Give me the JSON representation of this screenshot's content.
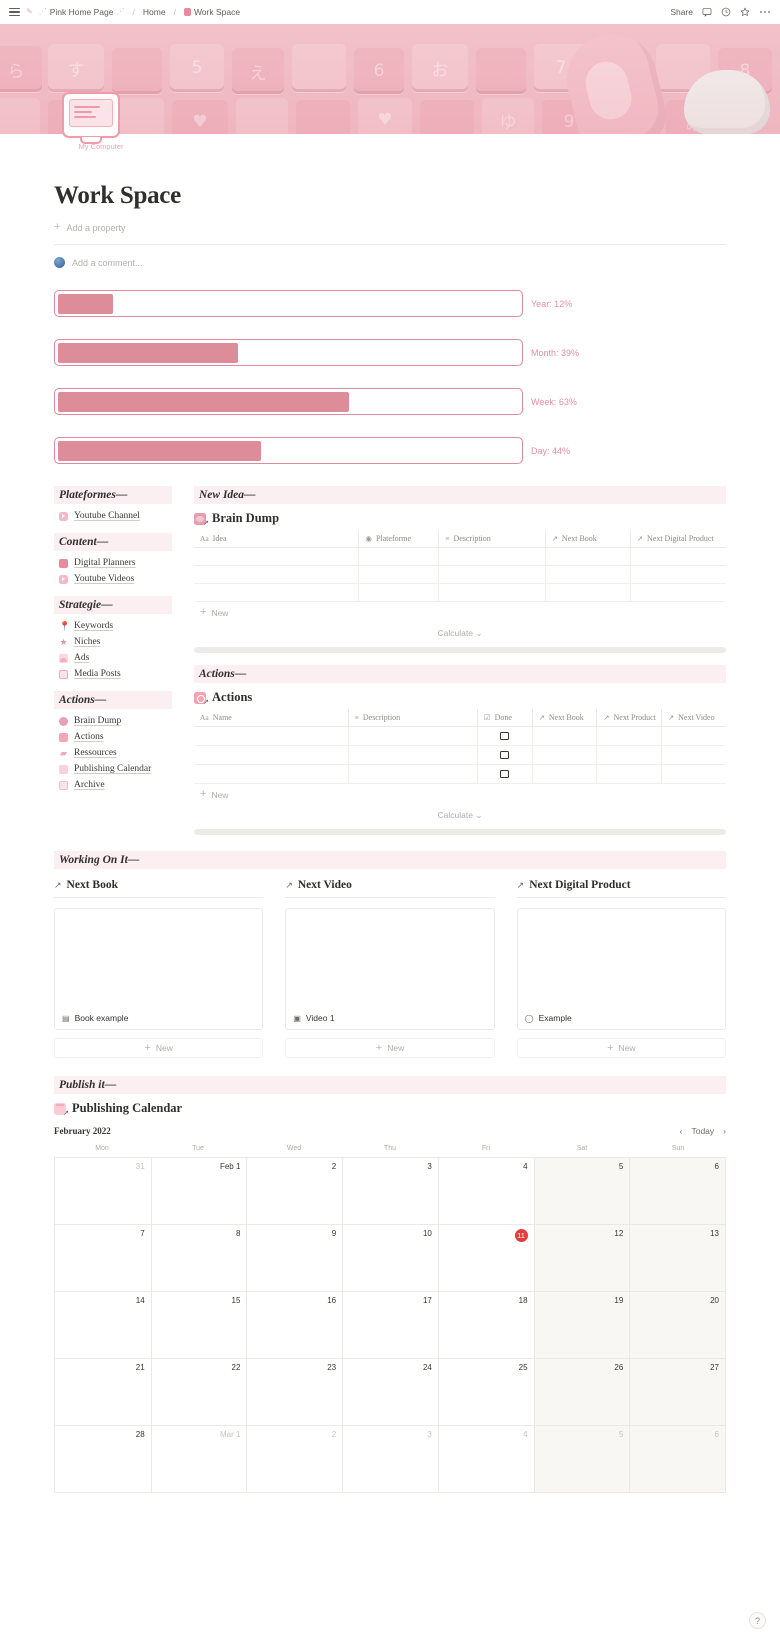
{
  "topbar": {
    "breadcrumbs": [
      {
        "icon": "pink-pen-icon",
        "label": "Pink Home Page"
      },
      {
        "icon": "",
        "label": "Home"
      },
      {
        "icon": "book-icon",
        "label": "Work Space"
      }
    ],
    "share_label": "Share",
    "icons": [
      "comment-icon",
      "clock-icon",
      "star-icon",
      "more-icon"
    ]
  },
  "page_icon": {
    "label": "My Computer"
  },
  "header": {
    "title": "Work Space",
    "add_property": "Add a property",
    "add_comment": "Add a comment..."
  },
  "progress": [
    {
      "label": "Year: 12%",
      "percent": 12
    },
    {
      "label": "Month: 39%",
      "percent": 39
    },
    {
      "label": "Week: 63%",
      "percent": 63
    },
    {
      "label": "Day: 44%",
      "percent": 44
    }
  ],
  "sidebar": {
    "groups": [
      {
        "heading": "Plateformes—",
        "items": [
          {
            "label": "Youtube Channel",
            "icon": "youtube-icon"
          }
        ]
      },
      {
        "heading": "Content—",
        "items": [
          {
            "label": "Digital Planners",
            "icon": "book-icon"
          },
          {
            "label": "Youtube Videos",
            "icon": "youtube-icon"
          }
        ]
      },
      {
        "heading": "Strategie—",
        "items": [
          {
            "label": "Keywords",
            "icon": "pin-icon"
          },
          {
            "label": "Niches",
            "icon": "star-icon"
          },
          {
            "label": "Ads",
            "icon": "image-icon"
          },
          {
            "label": "Media Posts",
            "icon": "media-icon"
          }
        ]
      },
      {
        "heading": "Actions—",
        "items": [
          {
            "label": "Brain Dump",
            "icon": "brain-icon"
          },
          {
            "label": "Actions",
            "icon": "actions-icon"
          },
          {
            "label": "Ressources",
            "icon": "ressources-icon"
          },
          {
            "label": "Publishing Calendar",
            "icon": "calendar-icon"
          },
          {
            "label": "Archive",
            "icon": "archive-icon"
          }
        ]
      }
    ]
  },
  "new_idea": {
    "heading": "New Idea—",
    "db_title": "Brain Dump",
    "db_icon": "brain-dump-icon",
    "columns": [
      {
        "label": "Idea",
        "type_glyph": "Aa"
      },
      {
        "label": "Plateforme",
        "type_glyph": "◉"
      },
      {
        "label": "Description",
        "type_glyph": "≡"
      },
      {
        "label": "Next Book",
        "type_glyph": "↗"
      },
      {
        "label": "Next Digital Product",
        "type_glyph": "↗"
      }
    ],
    "row_count": 3,
    "new_label": "New",
    "calculate_label": "Calculate"
  },
  "actions": {
    "heading": "Actions—",
    "db_title": "Actions",
    "db_icon": "actions-db-icon",
    "columns": [
      {
        "label": "Name",
        "type_glyph": "Aa"
      },
      {
        "label": "Description",
        "type_glyph": "≡"
      },
      {
        "label": "Done",
        "type_glyph": "☑"
      },
      {
        "label": "Next Book",
        "type_glyph": "↗"
      },
      {
        "label": "Next Product",
        "type_glyph": "↗"
      },
      {
        "label": "Next Video",
        "type_glyph": "↗"
      }
    ],
    "row_count": 3,
    "new_label": "New",
    "calculate_label": "Calculate"
  },
  "working_on_it": {
    "heading": "Working On It—",
    "galleries": [
      {
        "title": "Next Book",
        "card": "Book example",
        "card_icon": "page-icon",
        "new_label": "New"
      },
      {
        "title": "Next Video",
        "card": "Video 1",
        "card_icon": "video-icon",
        "new_label": "New"
      },
      {
        "title": "Next Digital Product",
        "card": "Example",
        "card_icon": "circle-icon",
        "new_label": "New"
      }
    ]
  },
  "publish": {
    "heading": "Publish it—",
    "db_title": "Publishing Calendar",
    "db_icon": "calendar-db-icon",
    "month": "February 2022",
    "today_label": "Today",
    "prev_label": "‹",
    "next_label": "›",
    "weekdays": [
      "Mon",
      "Tue",
      "Wed",
      "Thu",
      "Fri",
      "Sat",
      "Sun"
    ],
    "today_date": 11,
    "weeks": [
      [
        {
          "d": "31",
          "dim": true
        },
        {
          "d": "Feb 1"
        },
        {
          "d": "2"
        },
        {
          "d": "3"
        },
        {
          "d": "4"
        },
        {
          "d": "5",
          "we": true
        },
        {
          "d": "6",
          "we": true
        }
      ],
      [
        {
          "d": "7"
        },
        {
          "d": "8"
        },
        {
          "d": "9"
        },
        {
          "d": "10"
        },
        {
          "d": "11",
          "today": true
        },
        {
          "d": "12",
          "we": true
        },
        {
          "d": "13",
          "we": true
        }
      ],
      [
        {
          "d": "14"
        },
        {
          "d": "15"
        },
        {
          "d": "16"
        },
        {
          "d": "17"
        },
        {
          "d": "18"
        },
        {
          "d": "19",
          "we": true
        },
        {
          "d": "20",
          "we": true
        }
      ],
      [
        {
          "d": "21"
        },
        {
          "d": "22"
        },
        {
          "d": "23"
        },
        {
          "d": "24"
        },
        {
          "d": "25"
        },
        {
          "d": "26",
          "we": true
        },
        {
          "d": "27",
          "we": true
        }
      ],
      [
        {
          "d": "28"
        },
        {
          "d": "Mar 1",
          "dim": true
        },
        {
          "d": "2",
          "dim": true
        },
        {
          "d": "3",
          "dim": true
        },
        {
          "d": "4",
          "dim": true
        },
        {
          "d": "5",
          "we": true,
          "dim": true
        },
        {
          "d": "6",
          "we": true,
          "dim": true
        }
      ]
    ]
  },
  "help": {
    "label": "?"
  },
  "colors": {
    "accent": "#dd8c99",
    "accent_border": "#e08a9a",
    "heading_bg": "#fceff2",
    "today_red": "#e03e3e"
  }
}
